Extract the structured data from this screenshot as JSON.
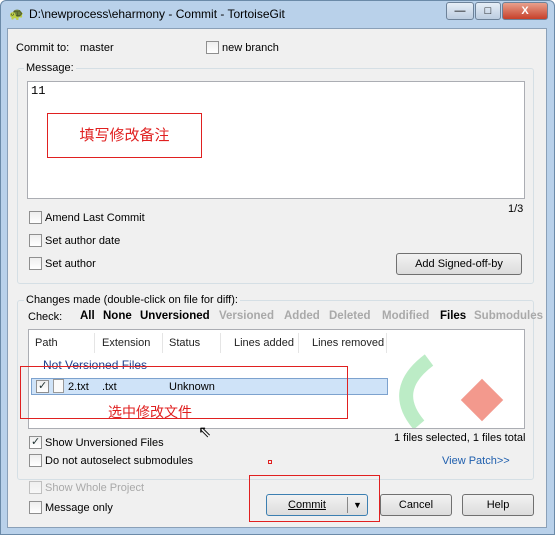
{
  "window": {
    "title": "D:\\newprocess\\eharmony - Commit - TortoiseGit",
    "minimize": "—",
    "maximize": "□",
    "close": "X"
  },
  "commit_to": {
    "label": "Commit to:",
    "branch": "master",
    "new_branch_label": "new branch",
    "new_branch_checked": false
  },
  "message": {
    "group_label": "Message:",
    "text": "11",
    "counter": "1/3",
    "annotation": "填写修改备注"
  },
  "options": {
    "amend": "Amend Last Commit",
    "set_author_date": "Set author date",
    "set_author": "Set author",
    "signed_off_button": "Add Signed-off-by"
  },
  "changes": {
    "group_label": "Changes made (double-click on file for diff):",
    "check_label": "Check:",
    "filters": [
      {
        "label": "All",
        "enabled": true
      },
      {
        "label": "None",
        "enabled": true
      },
      {
        "label": "Unversioned",
        "enabled": true
      },
      {
        "label": "Versioned",
        "enabled": false
      },
      {
        "label": "Added",
        "enabled": false
      },
      {
        "label": "Deleted",
        "enabled": false
      },
      {
        "label": "Modified",
        "enabled": false
      },
      {
        "label": "Files",
        "enabled": true
      },
      {
        "label": "Submodules",
        "enabled": false
      }
    ],
    "columns": [
      "Path",
      "Extension",
      "Status",
      "Lines added",
      "Lines removed"
    ],
    "section": "Not Versioned Files",
    "rows": [
      {
        "checked": true,
        "path": "2.txt",
        "extension": ".txt",
        "status": "Unknown",
        "lines_added": "",
        "lines_removed": ""
      }
    ],
    "annotation": "选中修改文件",
    "show_unversioned": "Show Unversioned Files",
    "show_unversioned_checked": true,
    "no_autoselect": "Do not autoselect submodules",
    "no_autoselect_checked": false,
    "summary": "1 files selected, 1 files total",
    "view_patch": "View Patch>>"
  },
  "bottom": {
    "show_whole_project": "Show Whole Project",
    "message_only": "Message only",
    "commit": "Commit",
    "cancel": "Cancel",
    "help": "Help"
  },
  "colors": {
    "accent_red": "#e02020",
    "link": "#1f5fae",
    "selection": "#cfe3f8"
  }
}
